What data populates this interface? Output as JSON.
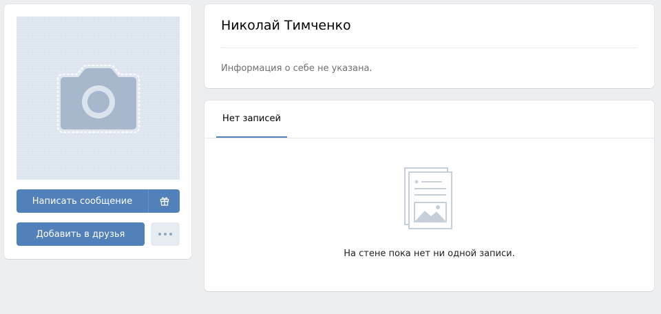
{
  "profile": {
    "name": "Николай Тимченко",
    "info": "Информация о себе не указана."
  },
  "actions": {
    "message_label": "Написать сообщение",
    "gift_icon": "gift-icon",
    "add_friend_label": "Добавить в друзья",
    "more_icon": "more-dots-icon"
  },
  "wall": {
    "tab_label": "Нет записей",
    "empty_text": "На стене пока нет ни одной записи.",
    "empty_icon": "document-image-icon"
  },
  "avatar": {
    "icon": "camera-icon"
  },
  "colors": {
    "accent": "#5181b8",
    "background": "#edeef0",
    "avatar_bg": "#dbe3ec",
    "muted_text": "#6f6f6f"
  }
}
